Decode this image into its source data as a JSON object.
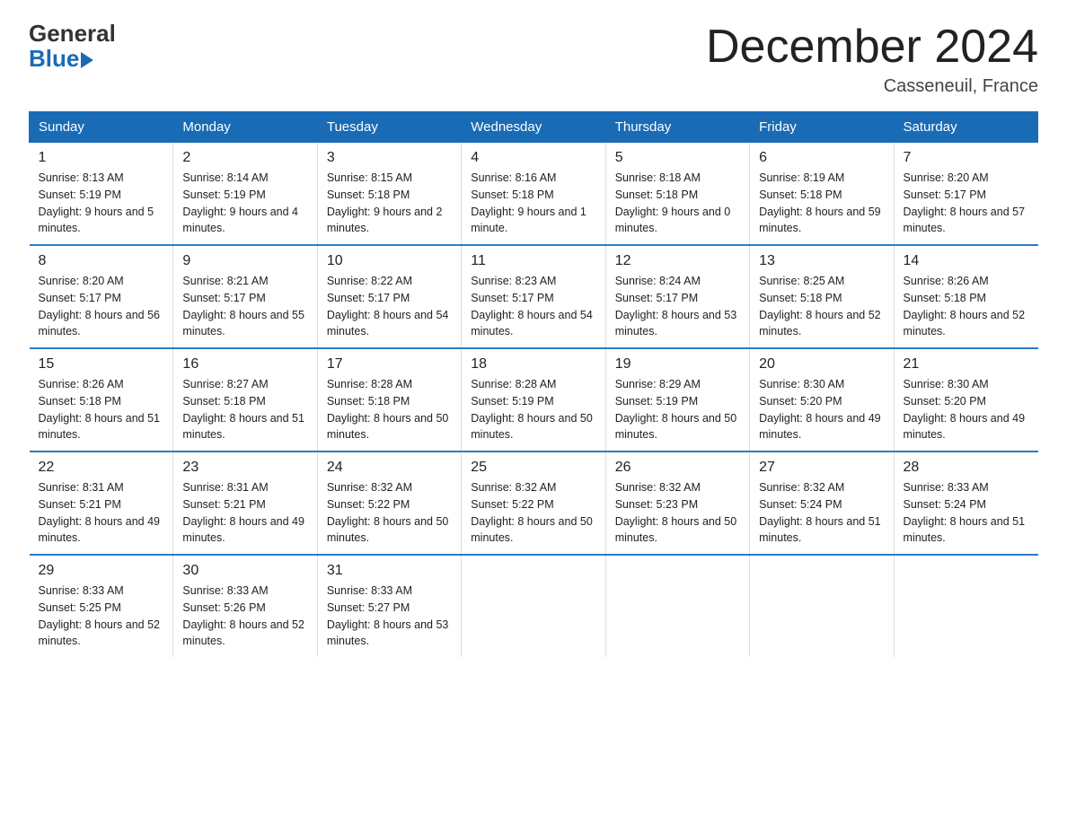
{
  "logo": {
    "general": "General",
    "blue": "Blue"
  },
  "title": "December 2024",
  "location": "Casseneuil, France",
  "days_of_week": [
    "Sunday",
    "Monday",
    "Tuesday",
    "Wednesday",
    "Thursday",
    "Friday",
    "Saturday"
  ],
  "weeks": [
    [
      {
        "num": "1",
        "sunrise": "8:13 AM",
        "sunset": "5:19 PM",
        "daylight": "9 hours and 5 minutes."
      },
      {
        "num": "2",
        "sunrise": "8:14 AM",
        "sunset": "5:19 PM",
        "daylight": "9 hours and 4 minutes."
      },
      {
        "num": "3",
        "sunrise": "8:15 AM",
        "sunset": "5:18 PM",
        "daylight": "9 hours and 2 minutes."
      },
      {
        "num": "4",
        "sunrise": "8:16 AM",
        "sunset": "5:18 PM",
        "daylight": "9 hours and 1 minute."
      },
      {
        "num": "5",
        "sunrise": "8:18 AM",
        "sunset": "5:18 PM",
        "daylight": "9 hours and 0 minutes."
      },
      {
        "num": "6",
        "sunrise": "8:19 AM",
        "sunset": "5:18 PM",
        "daylight": "8 hours and 59 minutes."
      },
      {
        "num": "7",
        "sunrise": "8:20 AM",
        "sunset": "5:17 PM",
        "daylight": "8 hours and 57 minutes."
      }
    ],
    [
      {
        "num": "8",
        "sunrise": "8:20 AM",
        "sunset": "5:17 PM",
        "daylight": "8 hours and 56 minutes."
      },
      {
        "num": "9",
        "sunrise": "8:21 AM",
        "sunset": "5:17 PM",
        "daylight": "8 hours and 55 minutes."
      },
      {
        "num": "10",
        "sunrise": "8:22 AM",
        "sunset": "5:17 PM",
        "daylight": "8 hours and 54 minutes."
      },
      {
        "num": "11",
        "sunrise": "8:23 AM",
        "sunset": "5:17 PM",
        "daylight": "8 hours and 54 minutes."
      },
      {
        "num": "12",
        "sunrise": "8:24 AM",
        "sunset": "5:17 PM",
        "daylight": "8 hours and 53 minutes."
      },
      {
        "num": "13",
        "sunrise": "8:25 AM",
        "sunset": "5:18 PM",
        "daylight": "8 hours and 52 minutes."
      },
      {
        "num": "14",
        "sunrise": "8:26 AM",
        "sunset": "5:18 PM",
        "daylight": "8 hours and 52 minutes."
      }
    ],
    [
      {
        "num": "15",
        "sunrise": "8:26 AM",
        "sunset": "5:18 PM",
        "daylight": "8 hours and 51 minutes."
      },
      {
        "num": "16",
        "sunrise": "8:27 AM",
        "sunset": "5:18 PM",
        "daylight": "8 hours and 51 minutes."
      },
      {
        "num": "17",
        "sunrise": "8:28 AM",
        "sunset": "5:18 PM",
        "daylight": "8 hours and 50 minutes."
      },
      {
        "num": "18",
        "sunrise": "8:28 AM",
        "sunset": "5:19 PM",
        "daylight": "8 hours and 50 minutes."
      },
      {
        "num": "19",
        "sunrise": "8:29 AM",
        "sunset": "5:19 PM",
        "daylight": "8 hours and 50 minutes."
      },
      {
        "num": "20",
        "sunrise": "8:30 AM",
        "sunset": "5:20 PM",
        "daylight": "8 hours and 49 minutes."
      },
      {
        "num": "21",
        "sunrise": "8:30 AM",
        "sunset": "5:20 PM",
        "daylight": "8 hours and 49 minutes."
      }
    ],
    [
      {
        "num": "22",
        "sunrise": "8:31 AM",
        "sunset": "5:21 PM",
        "daylight": "8 hours and 49 minutes."
      },
      {
        "num": "23",
        "sunrise": "8:31 AM",
        "sunset": "5:21 PM",
        "daylight": "8 hours and 49 minutes."
      },
      {
        "num": "24",
        "sunrise": "8:32 AM",
        "sunset": "5:22 PM",
        "daylight": "8 hours and 50 minutes."
      },
      {
        "num": "25",
        "sunrise": "8:32 AM",
        "sunset": "5:22 PM",
        "daylight": "8 hours and 50 minutes."
      },
      {
        "num": "26",
        "sunrise": "8:32 AM",
        "sunset": "5:23 PM",
        "daylight": "8 hours and 50 minutes."
      },
      {
        "num": "27",
        "sunrise": "8:32 AM",
        "sunset": "5:24 PM",
        "daylight": "8 hours and 51 minutes."
      },
      {
        "num": "28",
        "sunrise": "8:33 AM",
        "sunset": "5:24 PM",
        "daylight": "8 hours and 51 minutes."
      }
    ],
    [
      {
        "num": "29",
        "sunrise": "8:33 AM",
        "sunset": "5:25 PM",
        "daylight": "8 hours and 52 minutes."
      },
      {
        "num": "30",
        "sunrise": "8:33 AM",
        "sunset": "5:26 PM",
        "daylight": "8 hours and 52 minutes."
      },
      {
        "num": "31",
        "sunrise": "8:33 AM",
        "sunset": "5:27 PM",
        "daylight": "8 hours and 53 minutes."
      },
      null,
      null,
      null,
      null
    ]
  ],
  "labels": {
    "sunrise": "Sunrise:",
    "sunset": "Sunset:",
    "daylight": "Daylight:"
  }
}
